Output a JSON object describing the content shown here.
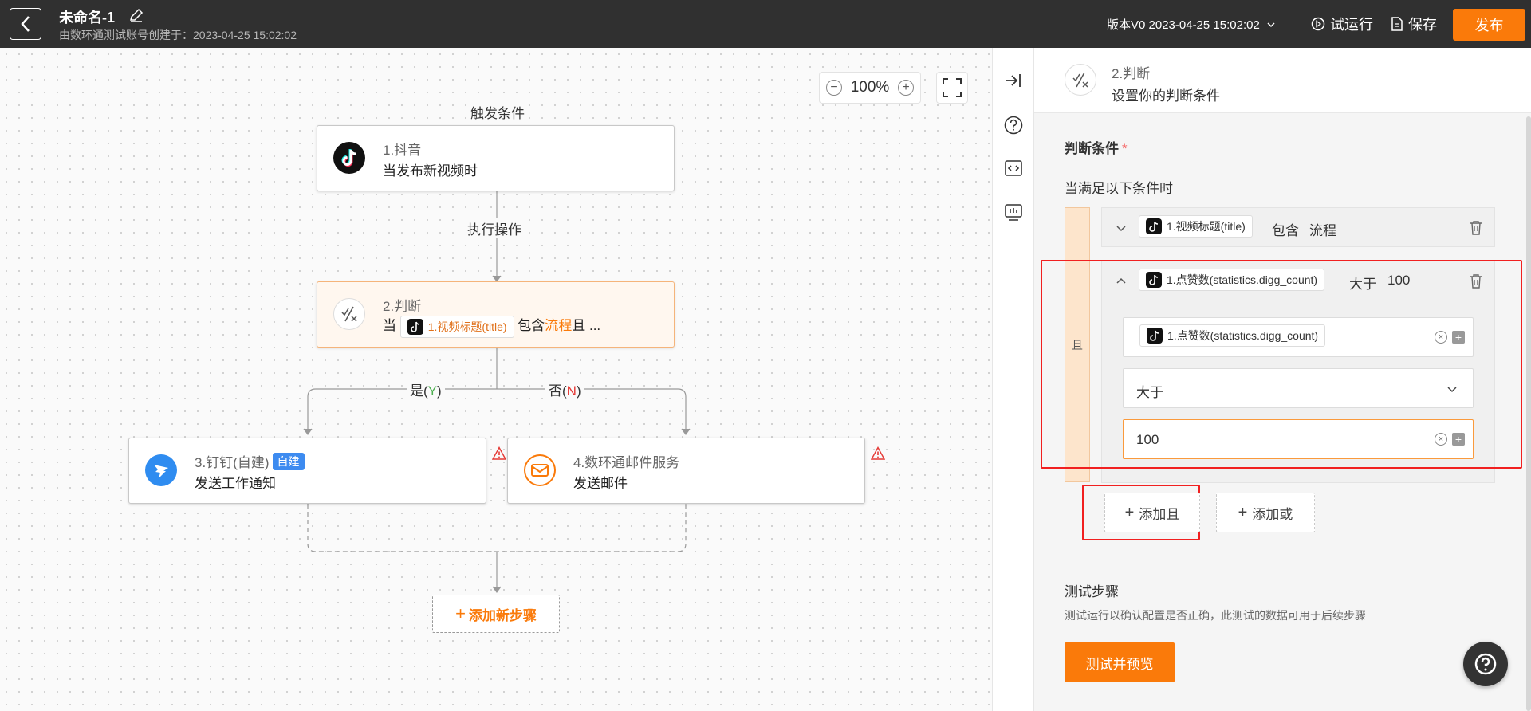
{
  "header": {
    "title": "未命名-1",
    "subtitle": "由数环通测试账号创建于：2023-04-25 15:02:02",
    "version": "版本V0 2023-04-25 15:02:02",
    "run_label": "试运行",
    "save_label": "保存",
    "publish_label": "发布"
  },
  "canvas": {
    "zoom_level": "100%",
    "trigger_label": "触发条件",
    "action_label": "执行操作",
    "branch_yes": {
      "prefix": "是(",
      "key": "Y",
      "suffix": ")"
    },
    "branch_no": {
      "prefix": "否(",
      "key": "N",
      "suffix": ")"
    },
    "add_step_label": "添加新步骤",
    "nodes": {
      "trigger": {
        "name": "1.抖音",
        "desc": "当发布新视频时"
      },
      "judge": {
        "name": "2.判断",
        "prefix": "当",
        "field": "1.视频标题(title)",
        "op": "包含",
        "value": "流程",
        "tail": "且 ..."
      },
      "dingtalk": {
        "name": "3.钉钉(自建)",
        "badge": "自建",
        "desc": "发送工作通知"
      },
      "mail": {
        "name": "4.数环通邮件服务",
        "desc": "发送邮件"
      }
    }
  },
  "panel": {
    "step_title": "2.判断",
    "step_subtitle": "设置你的判断条件",
    "section_title": "判断条件",
    "required_mark": "*",
    "condition_label": "当满足以下条件时",
    "and_label": "且",
    "conditions": [
      {
        "field": "1.视频标题(title)",
        "operator": "包含",
        "value": "流程",
        "expanded": false
      },
      {
        "field": "1.点赞数(statistics.digg_count)",
        "operator": "大于",
        "value": "100",
        "expanded": true
      }
    ],
    "editor": {
      "field_chip": "1.点赞数(statistics.digg_count)",
      "operator_selected": "大于",
      "value": "100"
    },
    "add_and_label": "添加且",
    "add_or_label": "添加或",
    "test_title": "测试步骤",
    "test_desc": "测试运行以确认配置是否正确，此测试的数据可用于后续步骤",
    "test_button": "测试并预览"
  },
  "colors": {
    "accent": "#fa7a0a",
    "header_bg": "#303030",
    "highlight": "#f12020",
    "yes": "#4caf50",
    "no": "#e53935"
  }
}
